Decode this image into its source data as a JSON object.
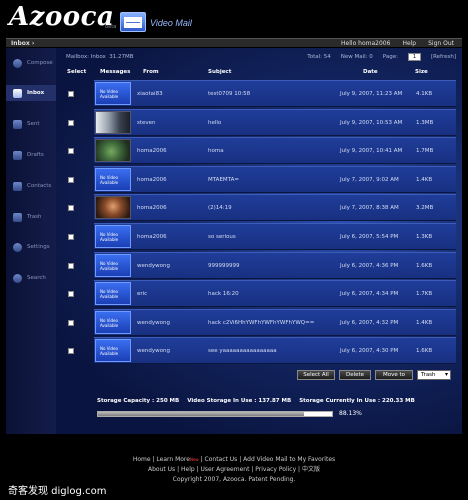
{
  "header": {
    "logo_text": "Azooca",
    "logo_beta": "beta",
    "product_name": "Video Mail",
    "logo_icon": "mail-icon"
  },
  "topbar": {
    "breadcrumb": "Inbox",
    "user": "Hello homa2006",
    "help": "Help",
    "signout": "Sign Out"
  },
  "sidebar": {
    "items": [
      {
        "label": "Compose",
        "icon": "compose-icon"
      },
      {
        "label": "Inbox",
        "icon": "inbox-icon"
      },
      {
        "label": "Sent",
        "icon": "sent-icon"
      },
      {
        "label": "Drafts",
        "icon": "drafts-icon"
      },
      {
        "label": "Contacts",
        "icon": "contacts-icon"
      },
      {
        "label": "Trash",
        "icon": "trash-icon"
      },
      {
        "label": "Settings",
        "icon": "settings-icon"
      },
      {
        "label": "Search",
        "icon": "search-icon"
      }
    ]
  },
  "mailbox": {
    "label": "Mailbox: Inbox",
    "size": "31.27MB",
    "total": "Total: 54",
    "new_mail": "New Mail: 0",
    "page_label": "Page:",
    "page": "1",
    "refresh": "[Refresh]"
  },
  "columns": {
    "select": "Select",
    "messages": "Messages",
    "from": "From",
    "subject": "Subject",
    "date": "Date",
    "size": "Size"
  },
  "no_video_text": "No Video Available",
  "messages": [
    {
      "from": "xiaotai83",
      "subject": "test0709 10:58",
      "date": "July 9, 2007, 11:23 AM",
      "size": "4.1KB",
      "thumb": "novideo"
    },
    {
      "from": "steven",
      "subject": "hello",
      "date": "July 9, 2007, 10:53 AM",
      "size": "1.3MB",
      "thumb": "img1"
    },
    {
      "from": "homa2006",
      "subject": "homa",
      "date": "July 9, 2007, 10:41 AM",
      "size": "1.7MB",
      "thumb": "img2"
    },
    {
      "from": "homa2006",
      "subject": "MTAEMTA=",
      "date": "July 7, 2007, 9:02 AM",
      "size": "1.4KB",
      "thumb": "novideo"
    },
    {
      "from": "homa2006",
      "subject": "(2)14:19",
      "date": "July 7, 2007, 8:38 AM",
      "size": "3.2MB",
      "thumb": "img3"
    },
    {
      "from": "homa2006",
      "subject": "so serious",
      "date": "July 6, 2007, 5:54 PM",
      "size": "1.3KB",
      "thumb": "novideo"
    },
    {
      "from": "wendywong",
      "subject": "999999999",
      "date": "July 6, 2007, 4:36 PM",
      "size": "1.6KB",
      "thumb": "novideo"
    },
    {
      "from": "eric",
      "subject": "hack 16:20",
      "date": "July 6, 2007, 4:34 PM",
      "size": "1.7KB",
      "thumb": "novideo"
    },
    {
      "from": "wendywong",
      "subject": "hack c2Vi6HhYWFhYWFhYWFhYWQ==",
      "date": "July 6, 2007, 4:32 PM",
      "size": "1.4KB",
      "thumb": "novideo"
    },
    {
      "from": "wendywong",
      "subject": "see yaaaaaaaaaaaaaaaa",
      "date": "July 6, 2007, 4:30 PM",
      "size": "1.6KB",
      "thumb": "novideo"
    }
  ],
  "toolbar": {
    "select_all": "Select All",
    "delete": "Delete",
    "move_to": "Move to",
    "folder": "Trash"
  },
  "storage": {
    "capacity": "Storage Capacity : 250 MB",
    "video_in_use": "Video Storage In Use : 137.87 MB",
    "currently_in_use": "Storage Currently In Use : 220.33 MB",
    "percent_used": 0.8813,
    "percent_text": "88.13%"
  },
  "footer": {
    "line1_a": "Home | Learn More",
    "new_badge": "New",
    "line1_b": "| Contact Us | Add Video Mail to My Favorites",
    "line2": "About Us | Help | User Agreement | Privacy Policy | 中文版",
    "line3": "Copyright 2007, Azooca. Patent Pending."
  },
  "watermark": "奇客发现 diglog.com"
}
